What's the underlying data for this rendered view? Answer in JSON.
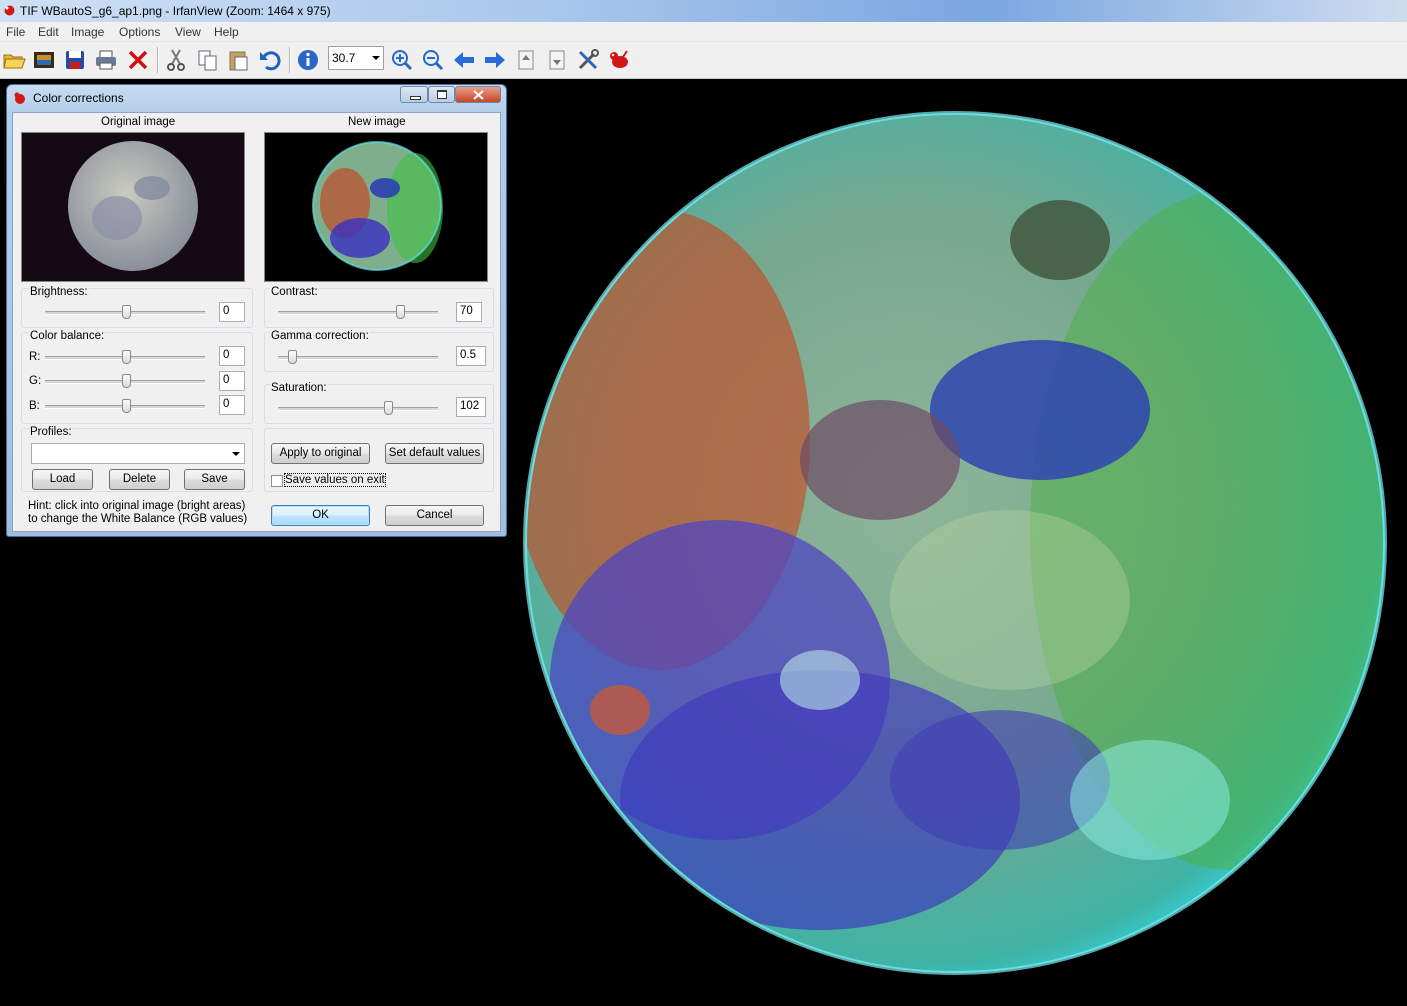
{
  "window": {
    "title": "TIF WBautoS_g6_ap1.png - IrfanView (Zoom: 1464 x 975)"
  },
  "menu": {
    "items": [
      "File",
      "Edit",
      "Image",
      "Options",
      "View",
      "Help"
    ]
  },
  "toolbar": {
    "zoom_value": "30.7",
    "icons": [
      "open-icon",
      "slideshow-icon",
      "save-icon",
      "print-icon",
      "delete-icon",
      "cut-icon",
      "copy-icon",
      "paste-icon",
      "undo-icon",
      "info-icon",
      "zoom-in-icon",
      "zoom-out-icon",
      "previous-icon",
      "next-icon",
      "first-page-icon",
      "last-page-icon",
      "settings-icon",
      "irfanview-icon"
    ]
  },
  "dialog": {
    "title": "Color corrections",
    "original_label": "Original image",
    "new_label": "New image",
    "brightness": {
      "label": "Brightness:",
      "value": "0",
      "level": 0
    },
    "contrast": {
      "label": "Contrast:",
      "value": "70",
      "level": 70
    },
    "color_balance": {
      "label": "Color balance:",
      "r": {
        "label": "R:",
        "value": "0",
        "level": 0
      },
      "g": {
        "label": "G:",
        "value": "0",
        "level": 0
      },
      "b": {
        "label": "B:",
        "value": "0",
        "level": 0
      }
    },
    "gamma": {
      "label": "Gamma correction:",
      "value": "0.5"
    },
    "saturation": {
      "label": "Saturation:",
      "value": "102"
    },
    "profiles": {
      "label": "Profiles:",
      "selected": ""
    },
    "buttons": {
      "load": "Load",
      "delete": "Delete",
      "save": "Save",
      "apply": "Apply to original",
      "defaults": "Set default values",
      "ok": "OK",
      "cancel": "Cancel"
    },
    "save_on_exit": {
      "label": "Save values on exit",
      "checked": false
    },
    "hint": "Hint: click into original image (bright areas) to change the White Balance (RGB values)"
  }
}
